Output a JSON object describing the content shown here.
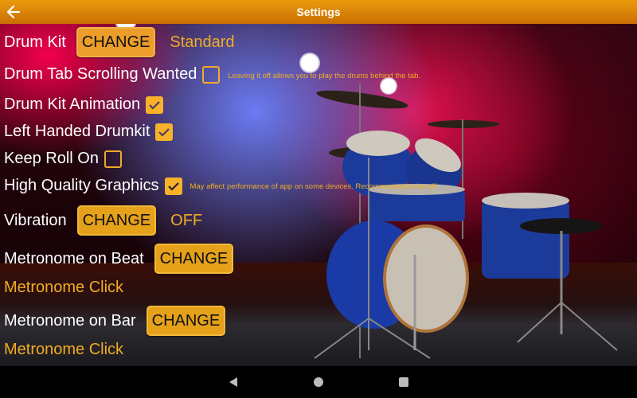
{
  "app_bar": {
    "title": "Settings",
    "back_icon": "arrow-left-icon",
    "background": "#d98106"
  },
  "accent_color": "#f0ac22",
  "settings": {
    "drum_kit": {
      "label": "Drum Kit",
      "button": "CHANGE",
      "value": "Standard"
    },
    "drum_tab_scrolling": {
      "label": "Drum Tab Scrolling Wanted",
      "checked": false,
      "hint": "Leaving it off allows you to play the drums behind the tab."
    },
    "drum_kit_animation": {
      "label": "Drum Kit Animation",
      "checked": true
    },
    "left_handed": {
      "label": "Left Handed Drumkit",
      "checked": true
    },
    "keep_roll_on": {
      "label": "Keep Roll On",
      "checked": false
    },
    "high_quality_graphics": {
      "label": "High Quality Graphics",
      "checked": true,
      "hint": "May affect performance of app on some devices. Recommended to be off."
    },
    "vibration": {
      "label": "Vibration",
      "button": "CHANGE",
      "value": "OFF"
    },
    "metronome_beat": {
      "label": "Metronome on Beat",
      "button": "CHANGE",
      "value": "Metronome Click"
    },
    "metronome_bar": {
      "label": "Metronome on Bar",
      "button": "CHANGE",
      "value": "Metronome Click"
    }
  },
  "background_image": "drum-kit-on-stage",
  "nav_bar": {
    "back": "nav-back-icon",
    "home": "nav-home-icon",
    "recents": "nav-recents-icon"
  }
}
